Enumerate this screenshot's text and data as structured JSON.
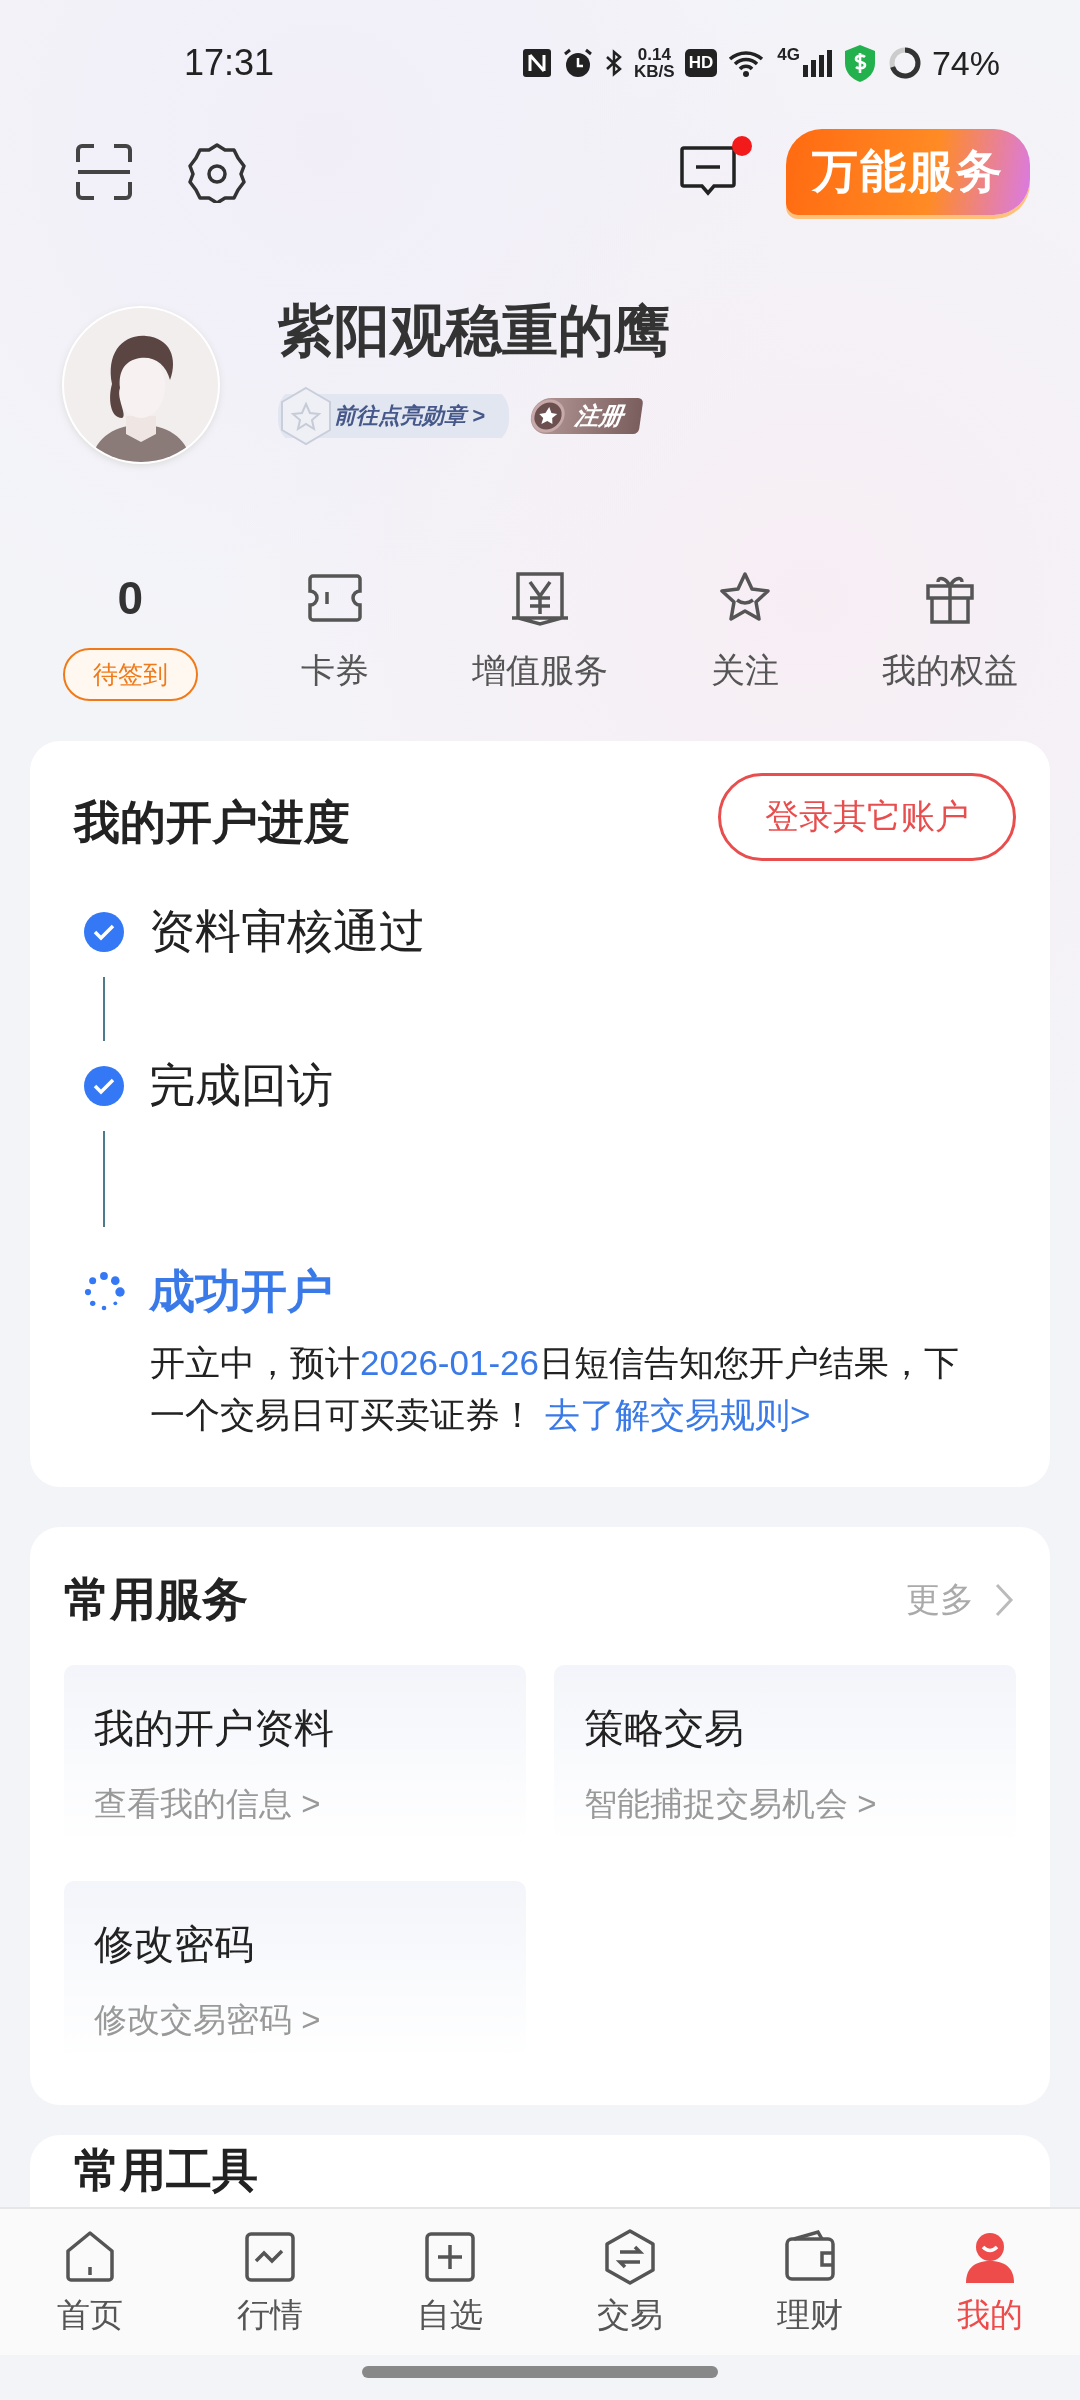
{
  "status_bar": {
    "time": "17:31",
    "speed": "0.14",
    "speed_unit": "KB/S",
    "hd": "HD",
    "network": "4G",
    "battery": "74%"
  },
  "header": {
    "service_button": "万能服务",
    "message_unread": true
  },
  "profile": {
    "name": "紫阳观稳重的鹰",
    "medal_link": "前往点亮勋章 >",
    "badge": "注册"
  },
  "stats": [
    {
      "kind": "count",
      "value": "0",
      "button": "待签到"
    },
    {
      "kind": "icon",
      "label": "卡券"
    },
    {
      "kind": "icon",
      "label": "增值服务"
    },
    {
      "kind": "icon",
      "label": "关注"
    },
    {
      "kind": "icon",
      "label": "我的权益"
    }
  ],
  "progress": {
    "title": "我的开户进度",
    "button": "登录其它账户",
    "steps": [
      {
        "done": true,
        "label": "资料审核通过"
      },
      {
        "done": true,
        "label": "完成回访"
      },
      {
        "done": false,
        "label": "成功开户"
      }
    ],
    "description": [
      {
        "kind": "plain",
        "text": "开立中，预计"
      },
      {
        "kind": "highlight",
        "text": "2026-01-26"
      },
      {
        "kind": "plain",
        "text": "日短信告知您开户结果，下一个交易日可买卖证券！"
      },
      {
        "kind": "link",
        "text": "去了解交易规则>"
      }
    ]
  },
  "services": {
    "title": "常用服务",
    "more": "更多",
    "items": [
      {
        "title": "我的开户资料",
        "subtitle": "查看我的信息 >"
      },
      {
        "title": "策略交易",
        "subtitle": "智能捕捉交易机会 >"
      },
      {
        "title": "修改密码",
        "subtitle": "修改交易密码 >"
      }
    ]
  },
  "tools": {
    "title": "常用工具"
  },
  "nav": [
    {
      "label": "首页",
      "selected": false
    },
    {
      "label": "行情",
      "selected": false
    },
    {
      "label": "自选",
      "selected": false
    },
    {
      "label": "交易",
      "selected": false
    },
    {
      "label": "理财",
      "selected": false
    },
    {
      "label": "我的",
      "selected": true
    }
  ]
}
